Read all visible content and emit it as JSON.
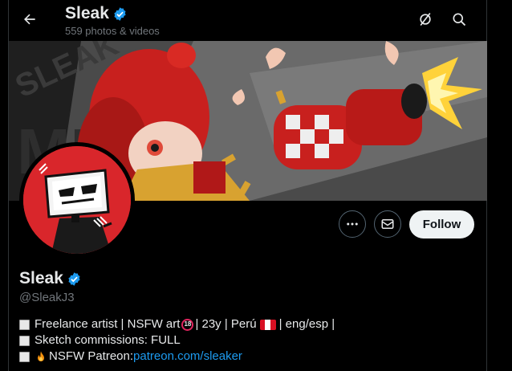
{
  "header": {
    "name": "Sleak",
    "media_count": "559 photos & videos"
  },
  "profile": {
    "display_name": "Sleak",
    "handle": "@SleakJ3",
    "verified": true
  },
  "actions": {
    "follow_label": "Follow"
  },
  "bio": {
    "line1_a": "Freelance artist | NSFW art",
    "line1_badge": "18",
    "line1_b": "| 23y | Perú",
    "line1_c": "| eng/esp |",
    "line2": "Sketch commissions: FULL",
    "line3_text": "NSFW Patreon: ",
    "line3_link": "patreon.com/sleaker"
  },
  "colors": {
    "accent": "#1d9bf0",
    "verified": "#1d9bf0",
    "avatar_bg": "#d9262b",
    "background": "#000000"
  },
  "icons": [
    "back-arrow-icon",
    "verified-badge-icon",
    "grok-icon",
    "search-icon",
    "more-options-icon",
    "message-icon",
    "fire-icon",
    "peru-flag-icon"
  ]
}
